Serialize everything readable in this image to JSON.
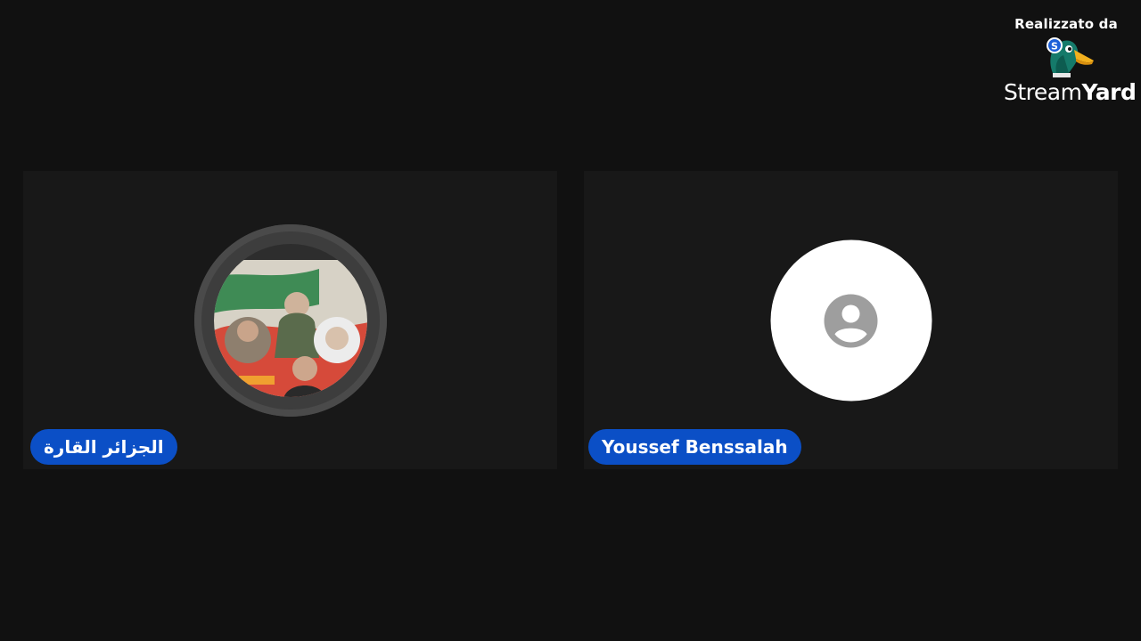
{
  "branding": {
    "label": "Realizzato da",
    "wordmark_part1": "Stream",
    "wordmark_part2": "Yard",
    "logo_icon": "duck-logo-icon"
  },
  "participants": [
    {
      "name": "الجزائر القارة",
      "avatar": "profile-photo"
    },
    {
      "name": "Youssef Benssalah",
      "avatar": "default-person-icon"
    }
  ],
  "colors": {
    "background": "#111111",
    "tile_background": "#181818",
    "name_pill": "#0b4fc6",
    "avatar_blank": "#ffffff",
    "person_icon": "#9e9e9e"
  }
}
